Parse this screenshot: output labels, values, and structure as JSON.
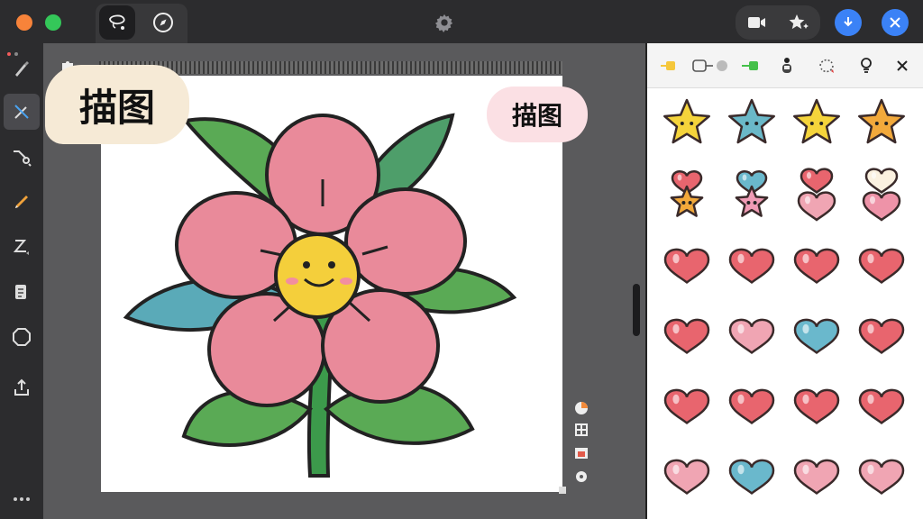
{
  "window": {
    "traffic_lights": [
      "#f7833a",
      "#34c759"
    ],
    "accent": "#3b82f6"
  },
  "toolbar": {
    "left_icons": [
      "lasso-select-icon",
      "compass-icon"
    ],
    "center_icon": "gear-icon",
    "right_icons": [
      "camera-add-icon",
      "sparkle-star-icon",
      "download-icon",
      "close-icon"
    ]
  },
  "tools": [
    "brush-icon",
    "magic-wand-icon",
    "eyedropper-icon",
    "pencil-icon",
    "pen-line-icon",
    "layers-icon",
    "shape-icon",
    "export-icon",
    "more-icon"
  ],
  "canvas": {
    "sticker_left": "描图",
    "sticker_right": "描图"
  },
  "panel": {
    "header_icons": [
      "fill-yellow-icon",
      "toggle-icon",
      "fill-green-icon",
      "figure-icon",
      "refresh-icon",
      "bulb-icon",
      "close-icon"
    ],
    "stickers": [
      [
        "star-yellow",
        "star-blue",
        "star-yellow",
        "star-orange"
      ],
      [
        "heart-star-orange",
        "heart-star-pink",
        "heart-pink-double",
        "heart-cream-double"
      ],
      [
        "heart-red",
        "heart-red",
        "heart-red",
        "heart-red"
      ],
      [
        "heart-red",
        "heart-pink",
        "heart-blue",
        "heart-red"
      ],
      [
        "heart-red",
        "heart-red",
        "heart-red",
        "heart-red"
      ],
      [
        "heart-pink",
        "heart-blue",
        "heart-pink",
        "heart-pink"
      ]
    ],
    "colors": {
      "star-yellow": "#f5d43b",
      "star-blue": "#6ab8c8",
      "star-orange": "#f2a93b",
      "heart-red": "#e8656e",
      "heart-pink": "#f0a5b3",
      "heart-blue": "#6ab8cc",
      "heart-cream": "#fbf1e0"
    }
  }
}
